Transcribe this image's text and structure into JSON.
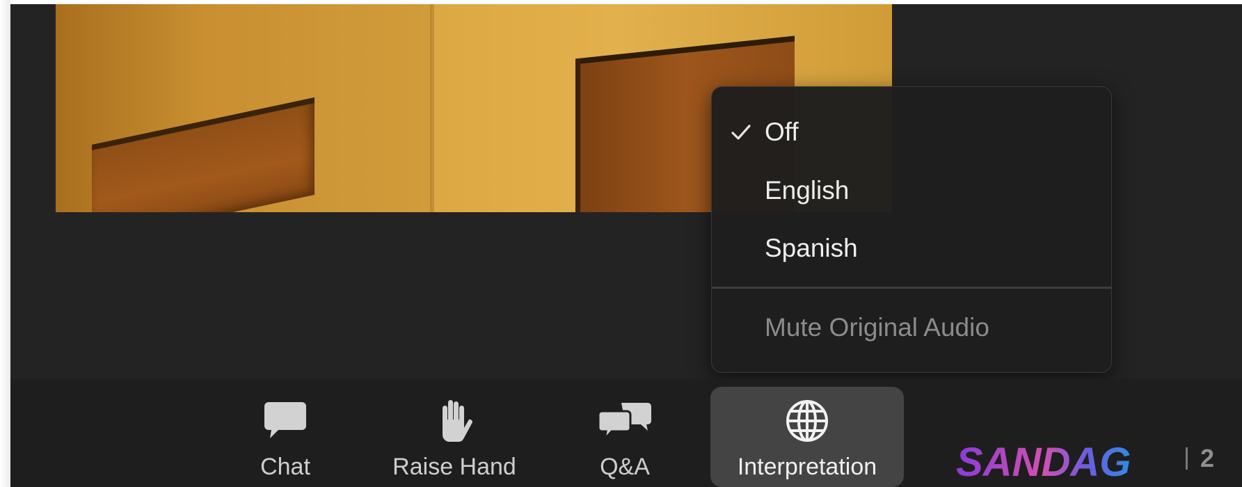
{
  "interpretation_menu": {
    "items": [
      {
        "label": "Off",
        "checked": true,
        "disabled": false
      },
      {
        "label": "English",
        "checked": false,
        "disabled": false
      },
      {
        "label": "Spanish",
        "checked": false,
        "disabled": false
      }
    ],
    "mute_original_audio": {
      "label": "Mute Original Audio",
      "disabled": true
    }
  },
  "toolbar": {
    "chat": {
      "label": "Chat",
      "icon": "chat-bubble-icon"
    },
    "raise_hand": {
      "label": "Raise Hand",
      "icon": "hand-icon"
    },
    "qa": {
      "label": "Q&A",
      "icon": "qa-bubbles-icon"
    },
    "interpretation": {
      "label": "Interpretation",
      "icon": "globe-icon",
      "active": true
    }
  },
  "branding": {
    "logo_text": "SANDAG",
    "page_number": "2"
  },
  "colors": {
    "background": "#232323",
    "menu_bg": "#1e1e1e",
    "menu_text": "#eeeeee",
    "disabled_text": "#8c8c8c",
    "active_button": "#444444",
    "logo_gradient_start": "#8a3bd8",
    "logo_gradient_end": "#2f8be6"
  }
}
